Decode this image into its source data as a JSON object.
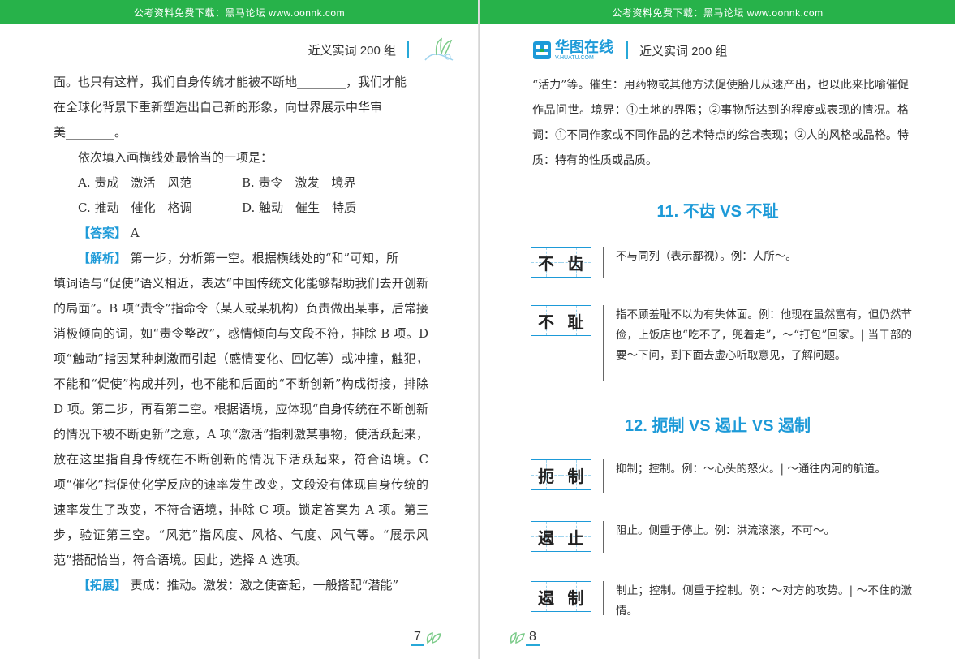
{
  "left": {
    "topbar": "公考资料免费下载：黑马论坛 www.oonnk.com",
    "header_title": "近义实词 200 组",
    "lines": {
      "l1": "面。也只有这样，我们自身传统才能被不断地________，我们才能",
      "l2": "在全球化背景下重新塑造出自己新的形象，向世界展示中华审",
      "l3": "美________。",
      "question": "依次填入画横线处最恰当的一项是：",
      "opt_a": "A. 责成　激活　风范",
      "opt_b": "B. 责令　激发　境界",
      "opt_c": "C. 推动　催化　格调",
      "opt_d": "D. 触动　催生　特质",
      "answer_tag": "【答案】",
      "answer": "A",
      "analysis_tag": "【解析】",
      "analysis_first": "第一步，分析第一空。根据横线处的“和”可知，所",
      "analysis_rest": "填词语与“促使”语义相近，表达“中国传统文化能够帮助我们去开创新的局面”。B 项“责令”指命令（某人或某机构）负责做出某事，后常接消极倾向的词，如“责令整改”，感情倾向与文段不符，排除 B 项。D 项“触动”指因某种刺激而引起（感情变化、回忆等）或冲撞，触犯，不能和“促使”构成并列，也不能和后面的“不断创新”构成衔接，排除 D 项。第二步，再看第二空。根据语境，应体现“自身传统在不断创新的情况下被不断更新”之意，A 项“激活”指刺激某事物，使活跃起来，放在这里指自身传统在不断创新的情况下活跃起来，符合语境。C 项“催化”指促使化学反应的速率发生改变，文段没有体现自身传统的速率发生了改变，不符合语境，排除 C 项。锁定答案为 A 项。第三步，验证第三空。“风范”指风度、风格、气度、风气等。“展示风范”搭配恰当，符合语境。因此，选择 A 选项。",
      "extend_tag": "【拓展】",
      "extend": "责成：推动。激发：激之使奋起，一般搭配“潜能”"
    },
    "page_number": "7"
  },
  "right": {
    "topbar": "公考资料免费下载：黑马论坛 www.oonnk.com",
    "logo_cn": "华图在线",
    "logo_url": "V.HUATU.COM",
    "header_title": "近义实词 200 组",
    "intro": "“活力”等。催生：用药物或其他方法促使胎儿从速产出，也以此来比喻催促作品问世。境界：①土地的界限；②事物所达到的程度或表现的情况。格调：①不同作家或不同作品的艺术特点的综合表现；②人的风格或品格。特质：特有的性质或品质。",
    "section11": "11. 不齿 VS 不耻",
    "section12": "12. 扼制 VS 遏止 VS 遏制",
    "entries": [
      {
        "c1": "不",
        "c2": "齿",
        "def": "不与同列（表示鄙视）。例：人所～。"
      },
      {
        "c1": "不",
        "c2": "耻",
        "def": "指不顾羞耻不以为有失体面。例：他现在虽然富有，但仍然节俭，上饭店也“吃不了，兜着走”，～“打包”回家。| 当干部的要～下问，到下面去虚心听取意见，了解问题。"
      },
      {
        "c1": "扼",
        "c2": "制",
        "def": "抑制；控制。例：～心头的怒火。| ～通往内河的航道。"
      },
      {
        "c1": "遏",
        "c2": "止",
        "def": "阻止。侧重于停止。例：洪流滚滚，不可～。"
      },
      {
        "c1": "遏",
        "c2": "制",
        "def": "制止；控制。侧重于控制。例：～对方的攻势。| ～不住的激情。"
      }
    ],
    "page_number": "8",
    "colors": {
      "green": "#27b24a",
      "blue": "#1d9ad8"
    }
  }
}
